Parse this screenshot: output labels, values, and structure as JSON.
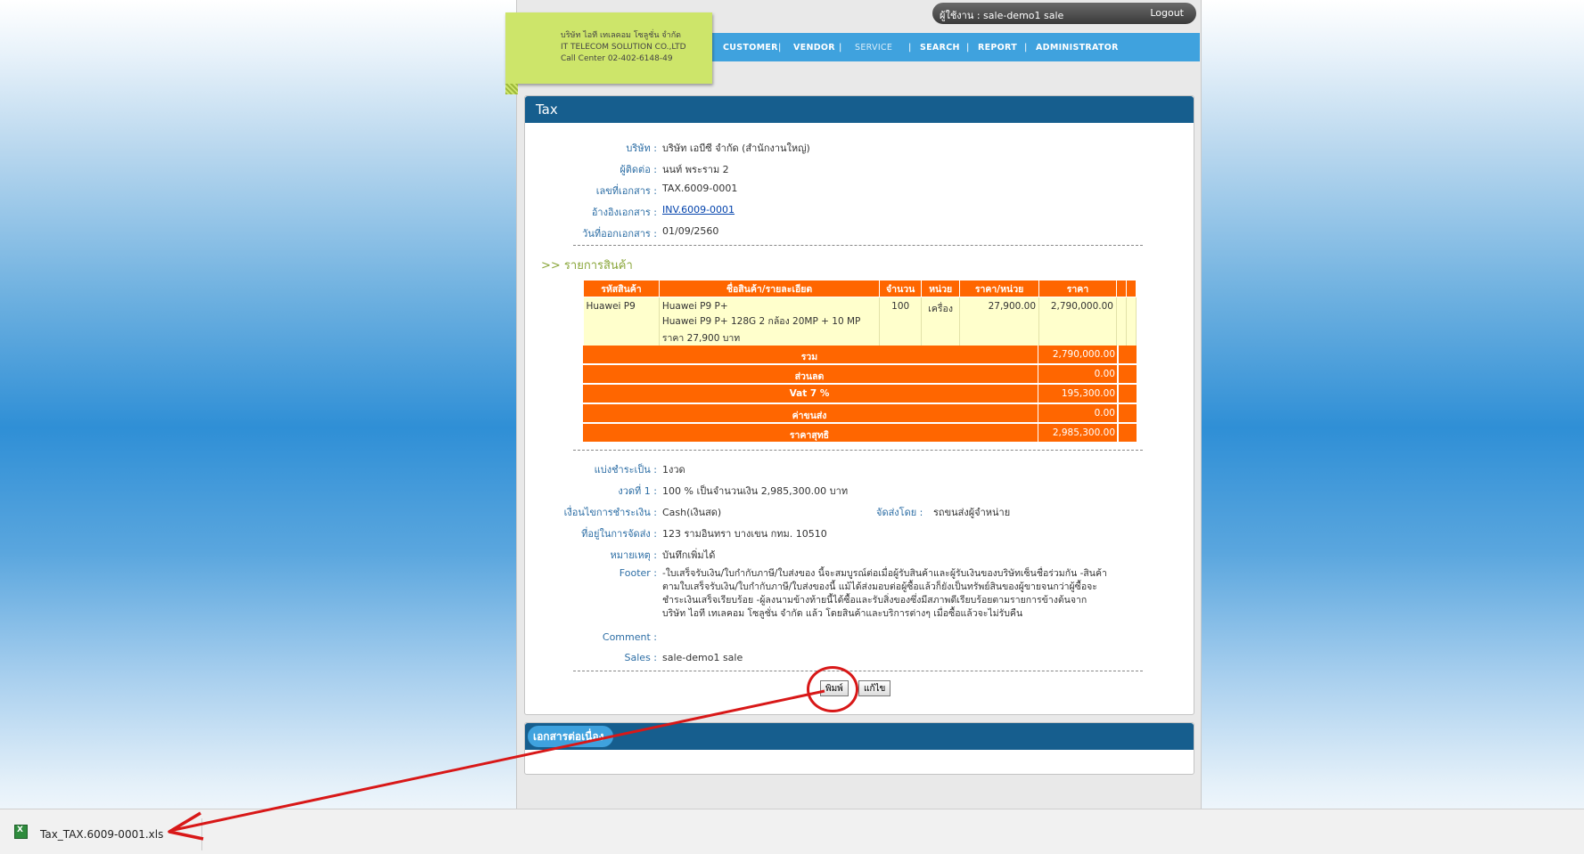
{
  "company": {
    "name_th": "บริษัท ไอที เทเลคอม โซลูชั่น จำกัด",
    "name_en": "IT TELECOM SOLUTION CO.,LTD",
    "call_center": "Call Center 02-402-6148-49"
  },
  "user_bar": {
    "user": "ผู้ใช้งาน : sale-demo1 sale",
    "logout": "Logout"
  },
  "nav": {
    "customer": "CUSTOMER",
    "vendor": "VENDOR",
    "service": "SERVICE",
    "search": "SEARCH",
    "report": "REPORT",
    "administrator": "ADMINISTRATOR",
    "separator": "|"
  },
  "panel": {
    "title": "Tax"
  },
  "doc": {
    "company_label": "บริษัท :",
    "company_value": "บริษัท เอบีซี จำกัด (สำนักงานใหญ่)",
    "contact_label": "ผู้ติดต่อ :",
    "contact_value": "นนท์ พระราม 2",
    "docno_label": "เลขที่เอกสาร :",
    "docno_value": "TAX.6009-0001",
    "ref_label": "อ้างอิงเอกสาร :",
    "ref_value": "INV.6009-0001",
    "date_label": "วันที่ออกเอกสาร :",
    "date_value": "01/09/2560"
  },
  "items_section": {
    "title": ">> รายการสินค้า"
  },
  "items_table": {
    "headers": [
      "รหัสสินค้า",
      "ชื่อสินค้า/รายละเอียด",
      "จำนวน",
      "หน่วย",
      "ราคา/หน่วย",
      "ราคา"
    ],
    "rows": [
      {
        "code": "Huawei P9",
        "name_line1": "Huawei P9 P+",
        "name_line2": "Huawei P9 P+ 128G 2 กล้อง 20MP + 10 MP",
        "name_line3": "ราคา 27,900 บาท",
        "qty": "100",
        "unit": "เครื่อง",
        "unit_price": "27,900.00",
        "price": "2,790,000.00"
      }
    ]
  },
  "totals": {
    "sum_label": "รวม",
    "sum_value": "2,790,000.00",
    "discount_label": "ส่วนลด",
    "discount_value": "0.00",
    "vat_label": "Vat 7 %",
    "vat_value": "195,300.00",
    "shipping_label": "ค่าขนส่ง",
    "shipping_value": "0.00",
    "net_label": "ราคาสุทธิ",
    "net_value": "2,985,300.00"
  },
  "payment": {
    "split_label": "แบ่งชำระเป็น :",
    "split_value": "1งวด",
    "inst_label": "งวดที่ 1 :",
    "inst_value": "100 % เป็นจำนวนเงิน 2,985,300.00 บาท",
    "cond_label": "เงื่อนไขการชำระเงิน :",
    "cond_value": "Cash(เงินสด)",
    "ship_by_label": "จัดส่งโดย :",
    "ship_by_value": "รถขนส่งผู้จำหน่าย",
    "address_label": "ที่อยู่ในการจัดส่ง :",
    "address_value": "123 รามอินทรา บางเขน กทม. 10510",
    "note_label": "หมายเหตุ :",
    "note_value": "บันทึกเพิ่มได้",
    "footer_label": "Footer :",
    "footer_line1": "-ใบเสร็จรับเงิน/ใบกำกับภาษี/ใบส่งของ นี้จะสมบูรณ์ต่อเมื่อผู้รับสินค้าและผู้รับเงินของบริษัทเซ็นชื่อร่วมกัน -สินค้า",
    "footer_line2": "ตามใบเสร็จรับเงิน/ใบกำกับภาษี/ใบส่งของนี้ แม้ได้ส่งมอบต่อผู้ซื้อแล้วก็ยังเป็นทรัพย์สินของผู้ขายจนกว่าผู้ซื้อจะ",
    "footer_line3": "ชำระเงินเสร็จเรียบร้อย -ผู้ลงนามข้างท้ายนี้ได้ซื้อและรับสิ่งของซึ่งมีสภาพดีเรียบร้อยตามรายการข้างต้นจาก",
    "footer_line4": "บริษัท ไอที เทเลคอม โซลูชั่น จำกัด แล้ว โดยสินค้าและบริการต่างๆ เมื่อซื้อแล้วจะไม่รับคืน",
    "comment_label": "Comment :",
    "comment_value": "",
    "sales_label": "Sales :",
    "sales_value": "sale-demo1 sale"
  },
  "buttons": {
    "print": "พิมพ์",
    "edit": "แก้ไข"
  },
  "related": {
    "title": "เอกสารต่อเนื่อง"
  },
  "download": {
    "filename": "Tax_TAX.6009-0001.xls",
    "icon": "excel-file-icon"
  },
  "colors": {
    "nav_blue": "#3fa2de",
    "panel_head": "#165e8e",
    "table_orange": "#ff6600",
    "row_yellow": "#ffffcc",
    "annotation_red": "#d81818"
  }
}
